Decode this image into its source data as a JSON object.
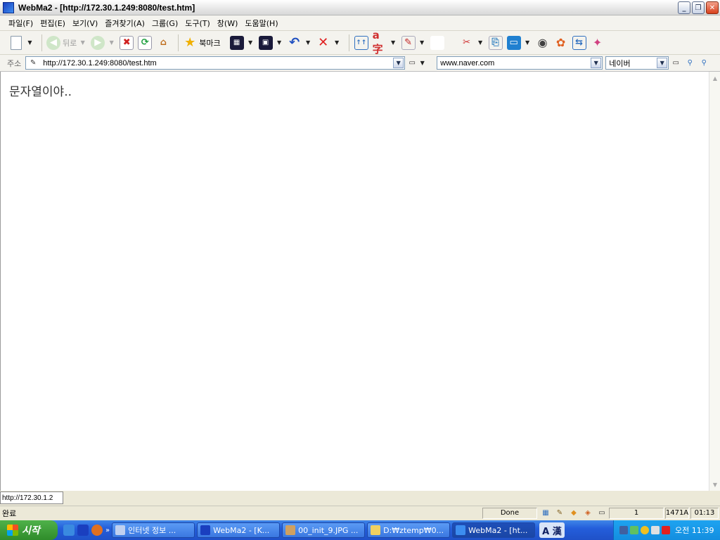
{
  "window": {
    "title": "WebMa2 - [http://172.30.1.249:8080/test.htm]"
  },
  "menu": [
    "파일(F)",
    "편집(E)",
    "보기(V)",
    "즐겨찾기(A)",
    "그룹(G)",
    "도구(T)",
    "창(W)",
    "도움말(H)"
  ],
  "toolbar": {
    "back_label": "뒤로",
    "bookmark_label": "북마크"
  },
  "address": {
    "label": "주소",
    "url": "http://172.30.1.249:8080/test.htm",
    "search_site": "www.naver.com",
    "search_engine": "네이버"
  },
  "content": {
    "text": "문자열이야.."
  },
  "status": {
    "link_preview": "http://172.30.1.2",
    "left": "완료",
    "done": "Done",
    "count": "1",
    "size": "1471A",
    "time": "01:13"
  },
  "taskbar": {
    "start_label": "시작",
    "tasks": [
      "인터넷 정보 ...",
      "WebMa2 - [K...",
      "00_init_9.JPG ...",
      "D:₩ztemp₩0...",
      "WebMa2 - [ht..."
    ],
    "ime": "A 漢",
    "clock": "오전 11:39"
  },
  "colors": {
    "title_bar": "#e6e6e6",
    "taskbar": "#245edb",
    "start_button": "#2f8c2a",
    "tray": "#1ea3f0"
  }
}
